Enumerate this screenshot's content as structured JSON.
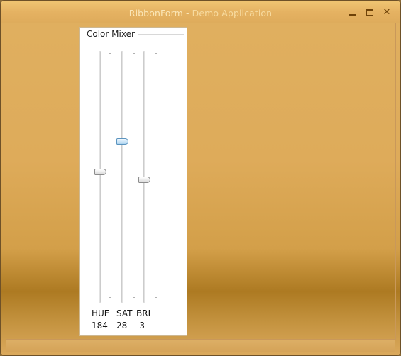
{
  "window": {
    "title_app": "RibbonForm",
    "title_separator": " - ",
    "title_doc": "Demo Application"
  },
  "color_mixer": {
    "group_title": "Color Mixer",
    "sliders": [
      {
        "label": "HUE",
        "value": "184",
        "position_fraction": 0.48,
        "active": false
      },
      {
        "label": "SAT",
        "value": "28",
        "position_fraction": 0.36,
        "active": true
      },
      {
        "label": "BRI",
        "value": "-3",
        "position_fraction": 0.51,
        "active": false
      }
    ]
  },
  "icons": {
    "minimize": "minimize-icon",
    "maximize": "maximize-icon",
    "close": "close-icon"
  }
}
